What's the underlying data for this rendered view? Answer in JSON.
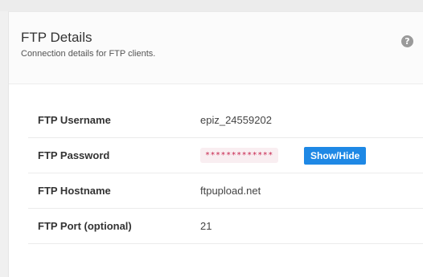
{
  "panel": {
    "title": "FTP Details",
    "subtitle": "Connection details for FTP clients.",
    "help_icon": "?"
  },
  "details": [
    {
      "label": "FTP Username",
      "value": "epiz_24559202"
    },
    {
      "label": "FTP Password",
      "value": "*************",
      "toggle_label": "Show/Hide"
    },
    {
      "label": "FTP Hostname",
      "value": "ftpupload.net"
    },
    {
      "label": "FTP Port (optional)",
      "value": "21"
    }
  ],
  "colors": {
    "accent": "#1e88e5",
    "password_text": "#c7254e",
    "password_bg": "#f9eef1"
  }
}
